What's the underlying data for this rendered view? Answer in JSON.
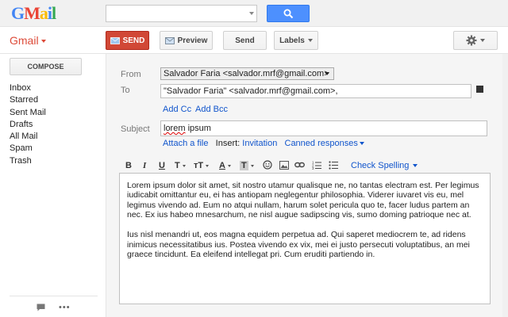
{
  "header": {
    "logo_text": [
      "G",
      "M",
      "a",
      "i",
      "l"
    ],
    "search": {
      "value": "",
      "placeholder": ""
    },
    "search_button_icon": "search-icon"
  },
  "subbar": {
    "app_label": "Gmail",
    "send_label": "SEND",
    "preview_label": "Preview",
    "send2_label": "Send",
    "labels_label": "Labels",
    "settings_icon": "gear-icon"
  },
  "sidebar": {
    "compose_label": "COMPOSE",
    "items": [
      {
        "label": "Inbox"
      },
      {
        "label": "Starred"
      },
      {
        "label": "Sent Mail"
      },
      {
        "label": "Drafts"
      },
      {
        "label": "All Mail"
      },
      {
        "label": "Spam"
      },
      {
        "label": "Trash"
      }
    ],
    "footer_icons": [
      "chat-icon",
      "more-icon"
    ],
    "more_glyph": "•••"
  },
  "compose": {
    "from_label": "From",
    "from_value": "Salvador Faria <salvador.mrf@gmail.com>",
    "to_label": "To",
    "to_value": "\"Salvador Faria\" <salvador.mrf@gmail.com>,",
    "add_cc": "Add Cc",
    "add_bcc": "Add Bcc",
    "subject_label": "Subject",
    "subject_word1": "lorem",
    "subject_word2": "ipsum",
    "attach_file": "Attach a file",
    "insert_label": "Insert:",
    "invitation": "Invitation",
    "canned_responses": "Canned responses",
    "check_spelling": "Check Spelling",
    "body_paragraphs": [
      "Lorem ipsum dolor sit amet, sit nostro utamur qualisque ne, no tantas electram est. Per legimus iudicabit omittantur eu, ei has antiopam neglegentur philosophia. Viderer iuvaret vis eu, mel legimus vivendo ad. Eum no atqui nullam, harum solet pericula quo te, facer ludus partem an nec. Ex ius habeo mnesarchum, ne nisl augue sadipscing vis, sumo doming patrioque nec at.",
      "Ius nisl menandri ut, eos magna equidem perpetua ad. Qui saperet mediocrem te, ad ridens inimicus necessitatibus ius. Postea vivendo ex vix, mei ei justo persecuti voluptatibus, an mei graece tincidunt. Ea eleifend intellegat pri. Cum eruditi partiendo in."
    ]
  },
  "format_toolbar": {
    "bold": "B",
    "italic": "I",
    "underline": "U",
    "font": "T",
    "size": "тT",
    "text_color": "A",
    "highlight": "T"
  },
  "colors": {
    "send_red": "#d14836",
    "search_blue": "#4d90fe",
    "link_blue": "#1155cc",
    "gmail_red": "#dd4b39"
  }
}
